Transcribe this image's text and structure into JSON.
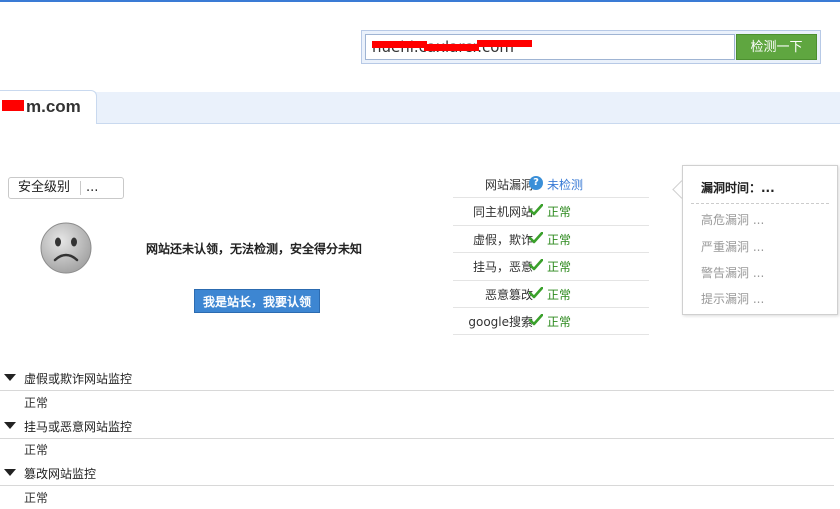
{
  "search": {
    "value": "nuehi.caxlarcr.com",
    "button_label": "检测一下"
  },
  "domain_tab": {
    "label": "m.com"
  },
  "security_level": {
    "label": "安全级别",
    "value": "..."
  },
  "claim": {
    "message": "网站还未认领，无法检测，安全得分未知",
    "button_label": "我是站长，我要认领"
  },
  "checks": [
    {
      "name": "网站漏洞",
      "status": "未检测",
      "icon": "question-icon"
    },
    {
      "name": "同主机网站",
      "status": "正常",
      "icon": "check-icon"
    },
    {
      "name": "虚假，欺诈",
      "status": "正常",
      "icon": "check-icon"
    },
    {
      "name": "挂马，恶意",
      "status": "正常",
      "icon": "check-icon"
    },
    {
      "name": "恶意篡改",
      "status": "正常",
      "icon": "check-icon"
    },
    {
      "name": "google搜索",
      "status": "正常",
      "icon": "check-icon"
    }
  ],
  "vuln_panel": {
    "title": "漏洞时间：...",
    "items": [
      "高危漏洞 ...",
      "严重漏洞 ...",
      "警告漏洞 ...",
      "提示漏洞 ..."
    ]
  },
  "monitors": [
    {
      "title": "虚假或欺诈网站监控",
      "status": "正常"
    },
    {
      "title": "挂马或恶意网站监控",
      "status": "正常"
    },
    {
      "title": "篡改网站监控",
      "status": "正常"
    }
  ],
  "colors": {
    "accent": "#3a7bd5",
    "ok": "#2d8a1e",
    "button_green": "#5fa640",
    "claim_blue": "#3d86d2"
  }
}
